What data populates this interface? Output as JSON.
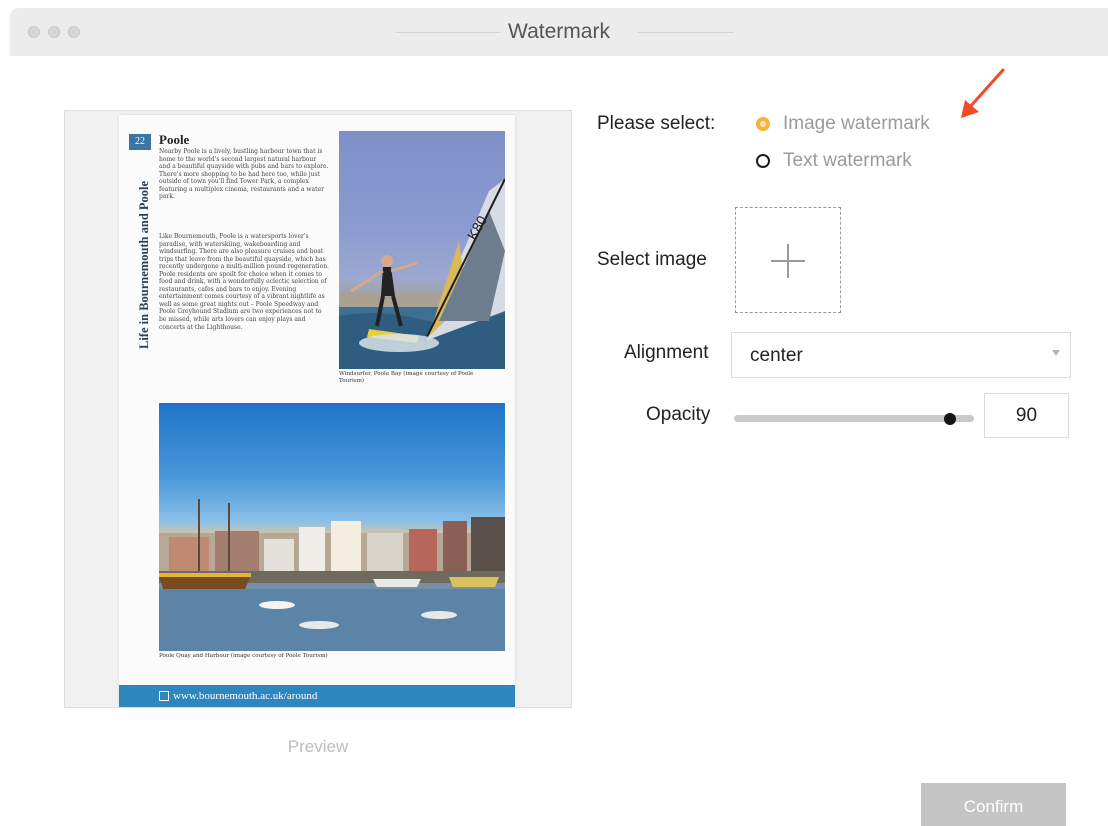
{
  "window": {
    "title": "Watermark"
  },
  "preview": {
    "label": "Preview",
    "document": {
      "page_number": "22",
      "vertical_title": "Life in Bournemouth and Poole",
      "heading": "Poole",
      "paragraph_1": "Nearby Poole is a lively, bustling harbour town that is home to the world's second largest natural harbour and a beautiful quayside with pubs and bars to explore. There's more shopping to be had here too, while just outside of town you'll find Tower Park, a complex featuring a multiplex cinema, restaurants and a water park.",
      "paragraph_2": "Like Bournemouth, Poole is a watersports lover's paradise, with waterskiing, wakeboarding and windsurfing. There are also pleasure cruises and boat trips that leave from the beautiful quayside, which has recently undergone a multi-million pound regeneration. Poole residents are spoilt for choice when it comes to food and drink, with a wonderfully eclectic selection of restaurants, cafes and bars to enjoy. Evening entertainment comes courtesy of a vibrant nightlife as well as some great nights out – Poole Speedway and Poole Greyhound Stadium are two experiences not to be missed, while arts lovers can enjoy plays and concerts at the Lighthouse.",
      "caption_1": "Windsurfer, Poole Bay (image courtesy of Poole Tourism)",
      "caption_2": "Poole Quay and Harbour (image courtesy of Poole Tourism)",
      "footer_url": "www.bournemouth.ac.uk/around"
    }
  },
  "form": {
    "please_select_label": "Please select:",
    "options": [
      {
        "label": "Image watermark",
        "selected": true
      },
      {
        "label": "Text watermark",
        "selected": false
      }
    ],
    "select_image_label": "Select image",
    "alignment_label": "Alignment",
    "alignment_value": "center",
    "opacity_label": "Opacity",
    "opacity_value": "90",
    "opacity_fraction": 0.9,
    "confirm_label": "Confirm"
  },
  "colors": {
    "accent_radio": "#f7b23b",
    "annotation_arrow": "#f04a26",
    "confirm_disabled": "#c5c5c5"
  }
}
